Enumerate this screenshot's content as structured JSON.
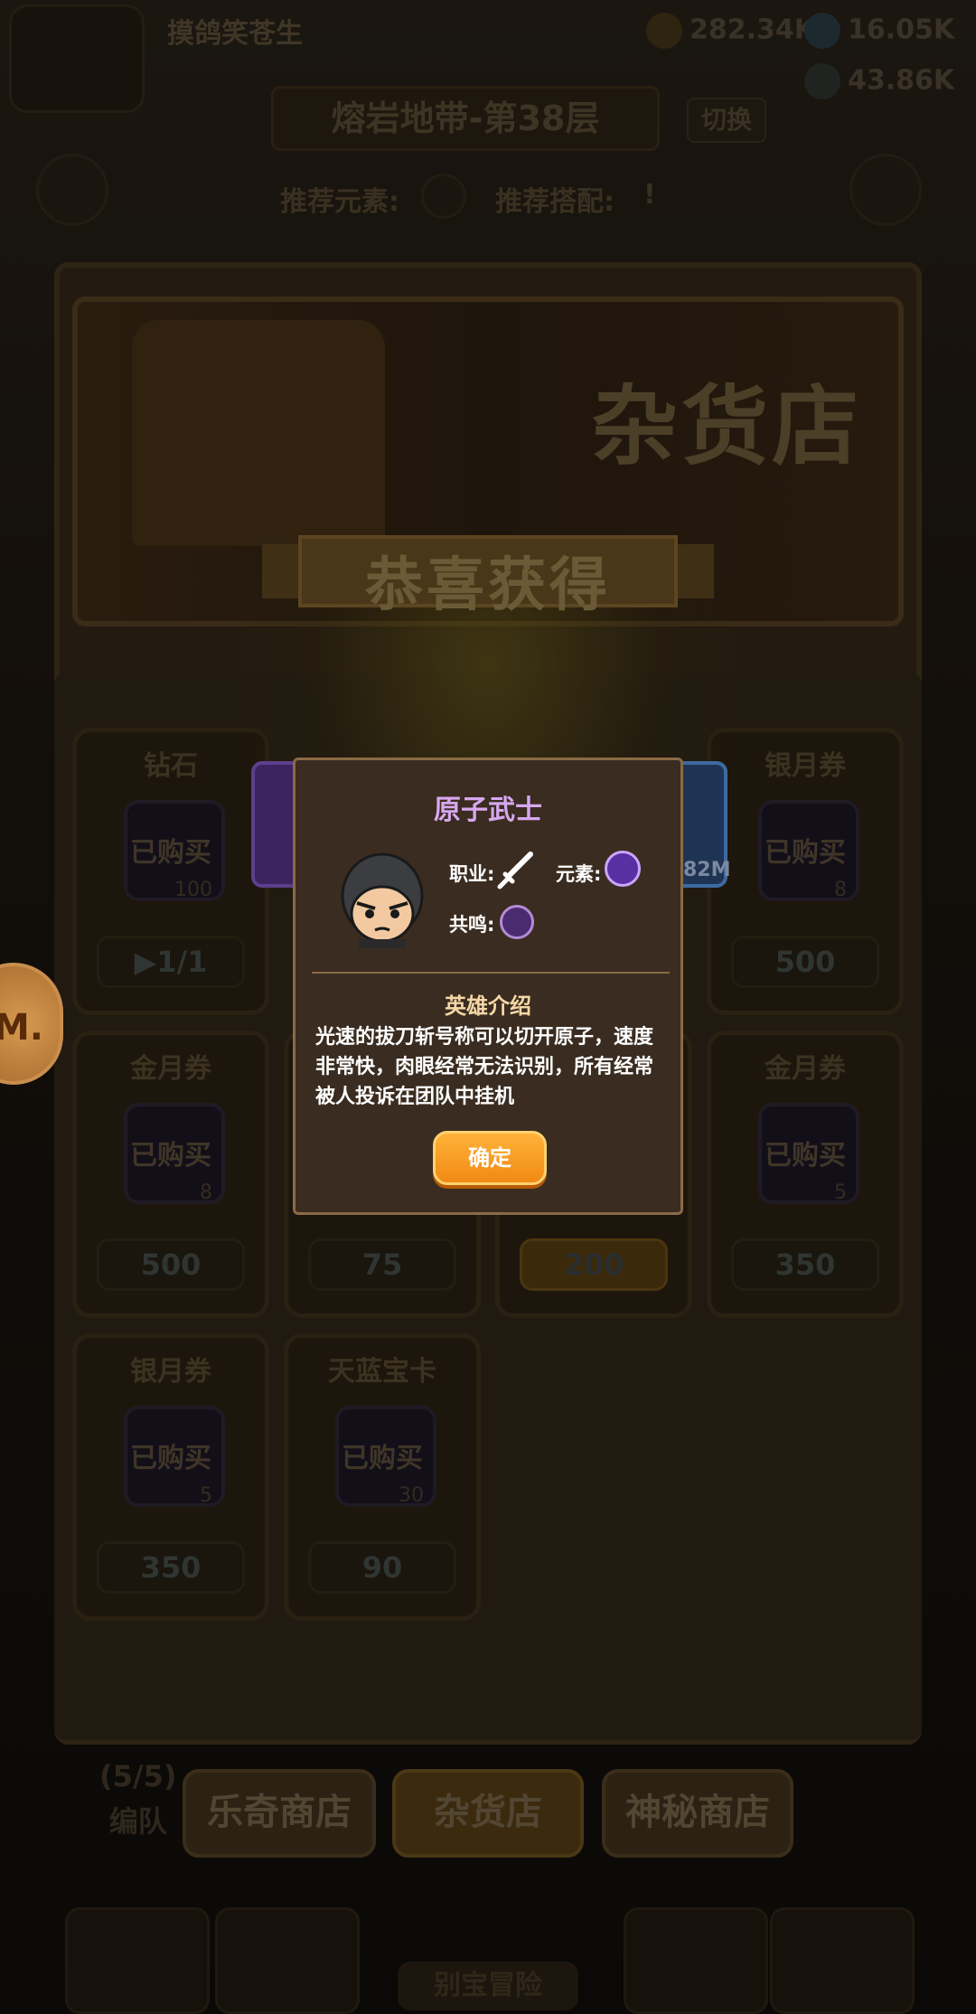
{
  "header": {
    "player_name": "摸鸽笑苍生",
    "gold": "282.34K",
    "gems": "16.05K",
    "energy": "43.86K"
  },
  "stage": {
    "name": "熔岩地带-第38层",
    "switch_label": "切换"
  },
  "recommend": {
    "element_label": "推荐元素:",
    "combo_label": "推荐搭配:",
    "combo_value": "!"
  },
  "shop": {
    "banner_title": "杂货店",
    "congrats": "恭喜获得",
    "cards": [
      {
        "name": "钻石",
        "status": "已购买",
        "qty": "100",
        "price": "1/1"
      },
      {
        "name": "银月券",
        "status": "已购买",
        "qty": "8",
        "price": "500"
      },
      {
        "name": "金月券",
        "status": "已购买",
        "qty": "8",
        "price": "500"
      },
      {
        "name": "",
        "status": "",
        "qty": "",
        "price": "75"
      },
      {
        "name": "",
        "status": "",
        "qty": "",
        "price": "200"
      },
      {
        "name": "金月券",
        "status": "已购买",
        "qty": "5",
        "price": "350"
      },
      {
        "name": "银月券",
        "status": "已购买",
        "qty": "5",
        "price": "350"
      },
      {
        "name": "天蓝宝卡",
        "status": "已购买",
        "qty": "30",
        "price": "90"
      }
    ],
    "partial_value": "82M"
  },
  "tabs": [
    "乐奇商店",
    "杂货店",
    "神秘商店"
  ],
  "team": {
    "count": "(5/5)",
    "label": "编队"
  },
  "bottom": {
    "explore": "别宝冒险"
  },
  "dialog": {
    "hero_name": "原子武士",
    "job_label": "职业:",
    "element_label": "元素:",
    "resonance_label": "共鸣:",
    "intro_title": "英雄介绍",
    "intro_text": "光速的拔刀斩号称可以切开原子，速度非常快，肉眼经常无法识别，所有经常被人投诉在团队中挂机",
    "ok_label": "确定"
  },
  "colors": {
    "title_purple": "#d7a8f0",
    "ok_orange": "#f08a14",
    "dialog_bg": "#3a2c20"
  }
}
